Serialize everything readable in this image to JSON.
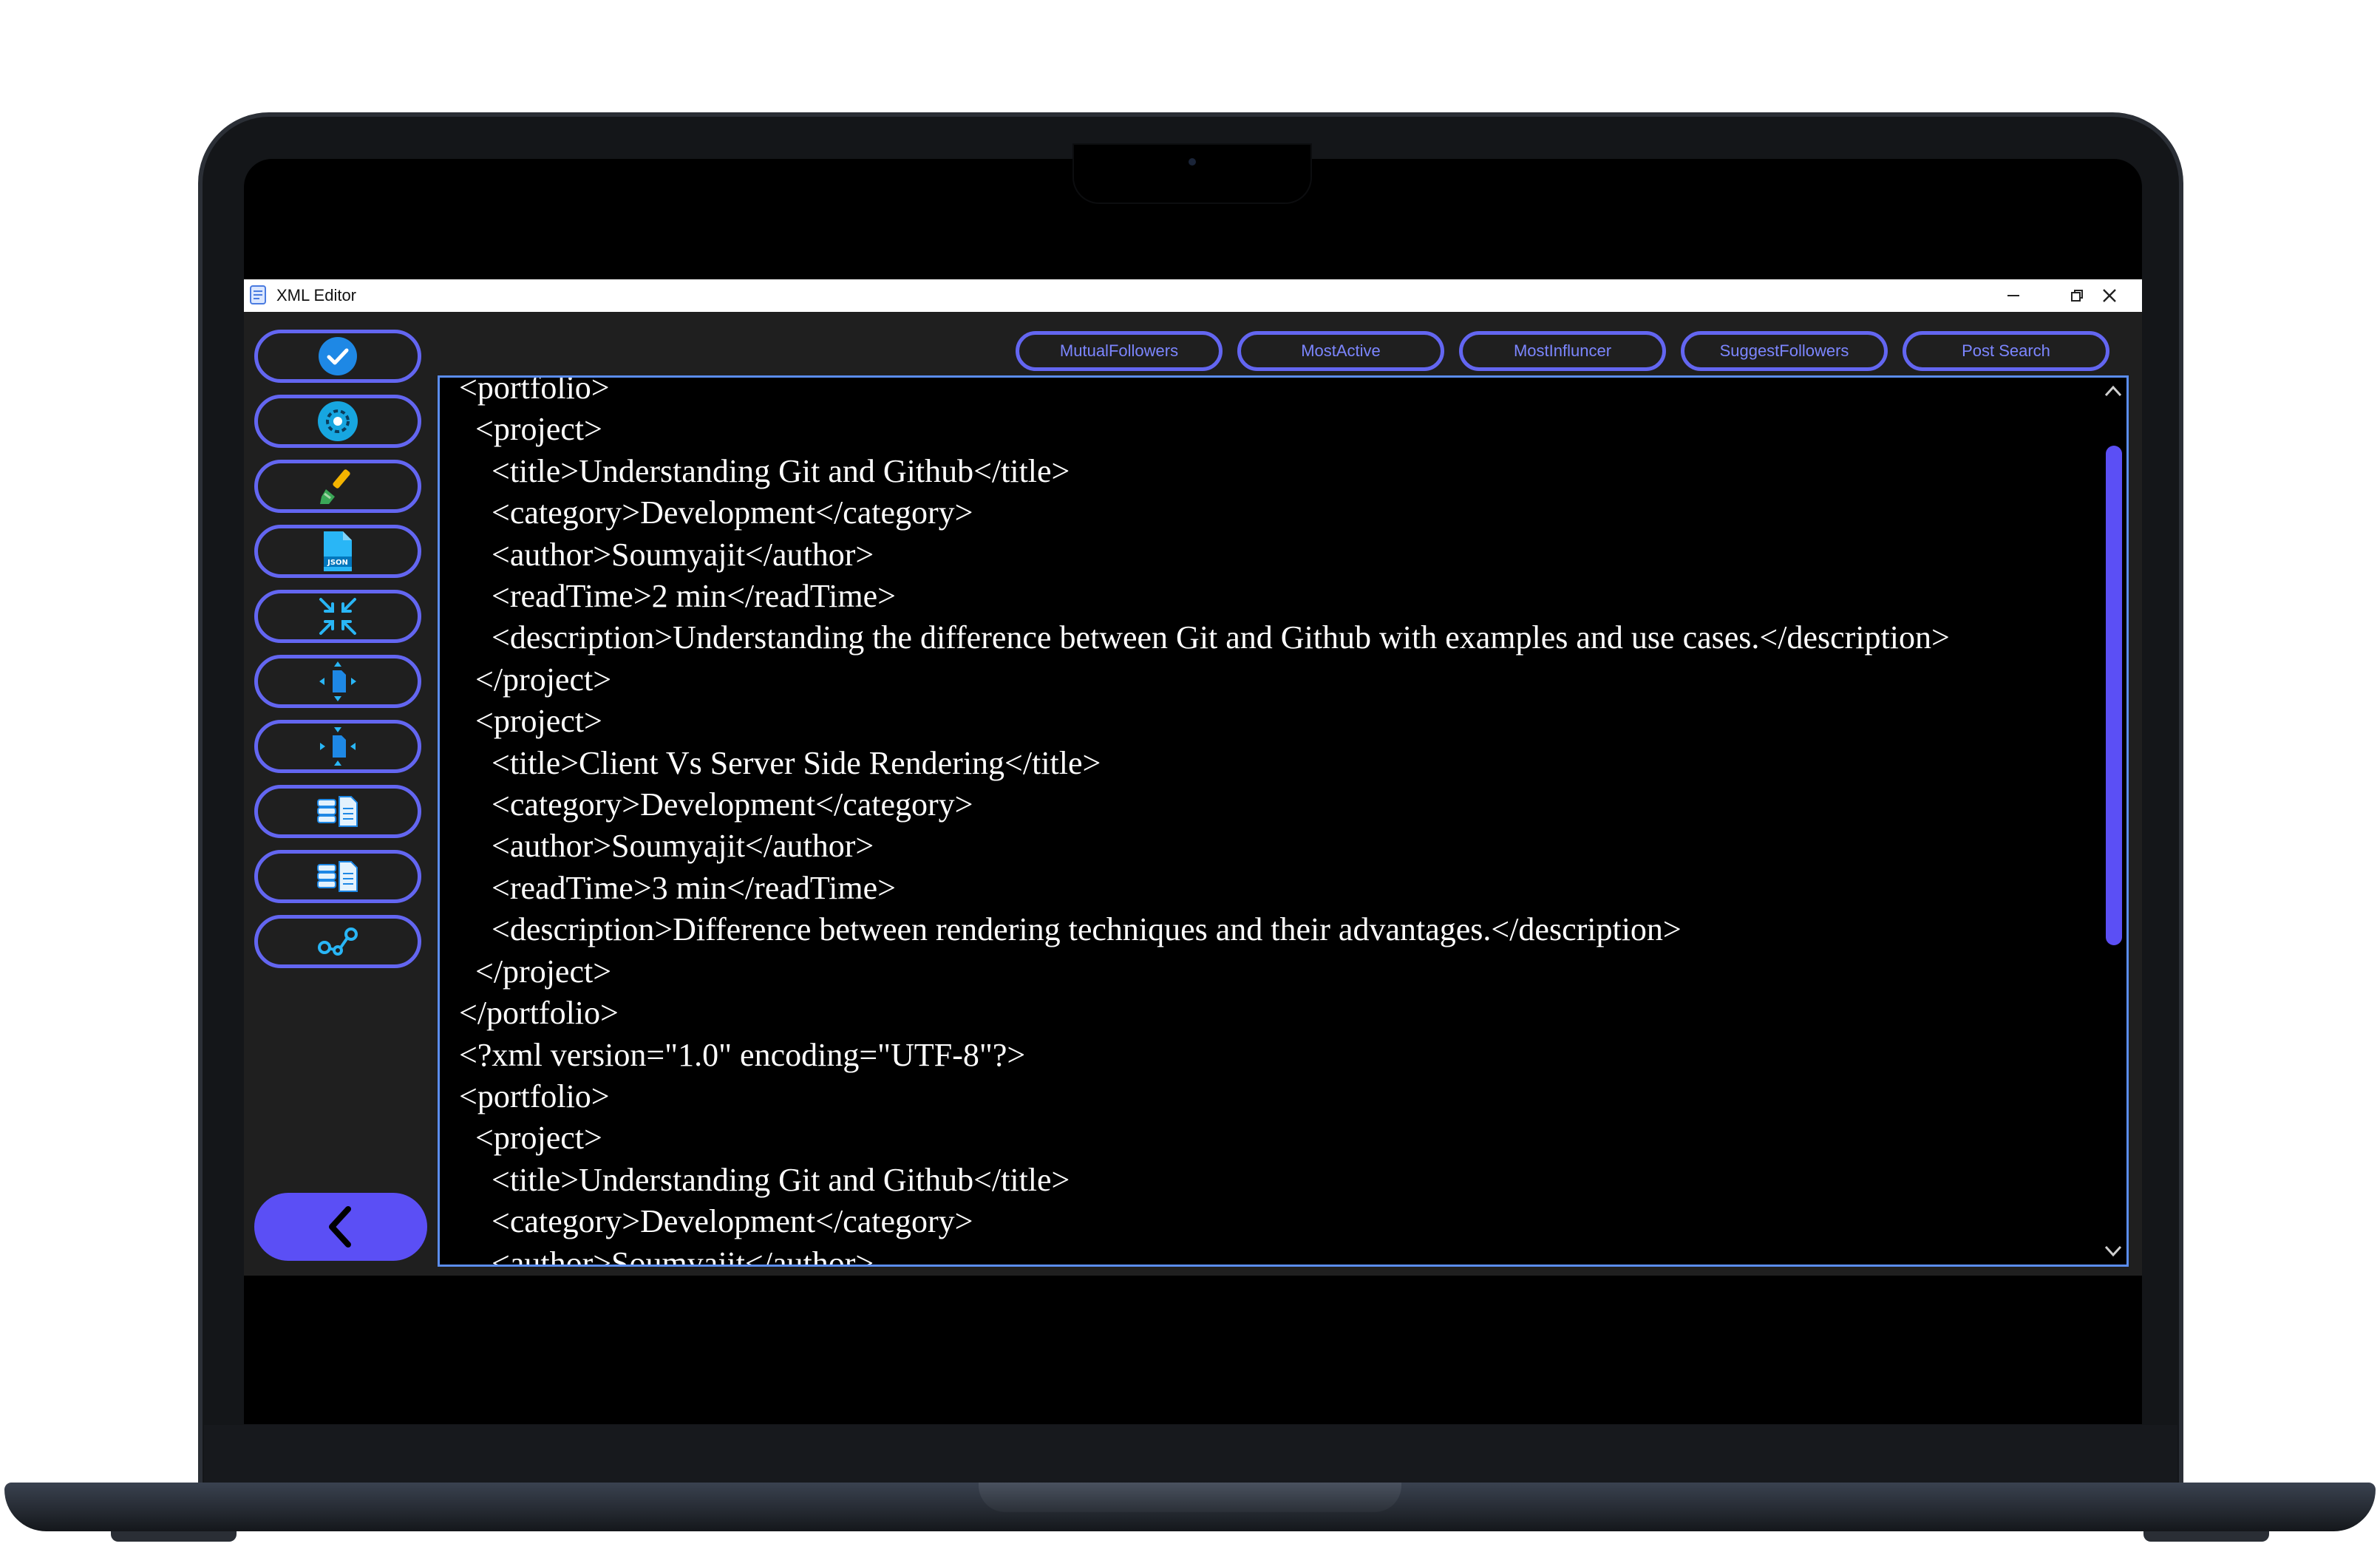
{
  "window": {
    "title": "XML Editor"
  },
  "feature_buttons": [
    {
      "label": "MutualFollowers"
    },
    {
      "label": "MostActive"
    },
    {
      "label": "MostInfluncer"
    },
    {
      "label": "SuggestFollowers"
    },
    {
      "label": "Post Search"
    }
  ],
  "sidebar": {
    "tools": [
      {
        "icon": "check-circle-icon"
      },
      {
        "icon": "settings-icon"
      },
      {
        "icon": "brush-icon"
      },
      {
        "icon": "json-file-icon"
      },
      {
        "icon": "minimize-arrows-icon"
      },
      {
        "icon": "compress-icon"
      },
      {
        "icon": "decompress-icon"
      },
      {
        "icon": "database-file-icon"
      },
      {
        "icon": "database-file-icon"
      },
      {
        "icon": "graph-icon"
      }
    ],
    "back_icon": "chevron-left-icon"
  },
  "editor": {
    "lines": [
      "<portfolio>",
      "  <project>",
      "    <title>Understanding Git and Github</title>",
      "    <category>Development</category>",
      "    <author>Soumyajit</author>",
      "    <readTime>2 min</readTime>",
      "    <description>Understanding the difference between Git and Github with examples and use cases.</description>",
      "  </project>",
      "  <project>",
      "    <title>Client Vs Server Side Rendering</title>",
      "    <category>Development</category>",
      "    <author>Soumyajit</author>",
      "    <readTime>3 min</readTime>",
      "    <description>Difference between rendering techniques and their advantages.</description>",
      "  </project>",
      "</portfolio>",
      "<?xml version=\"1.0\" encoding=\"UTF-8\"?>",
      "<portfolio>",
      "  <project>",
      "    <title>Understanding Git and Github</title>",
      "    <category>Development</category>",
      "    <author>Soumyajit</author>"
    ]
  },
  "colors": {
    "accent": "#6366f1",
    "back_button": "#5b4ff5",
    "editor_border": "#5b8def",
    "editor_bg": "#000000",
    "window_bg": "#1f1f1f"
  }
}
